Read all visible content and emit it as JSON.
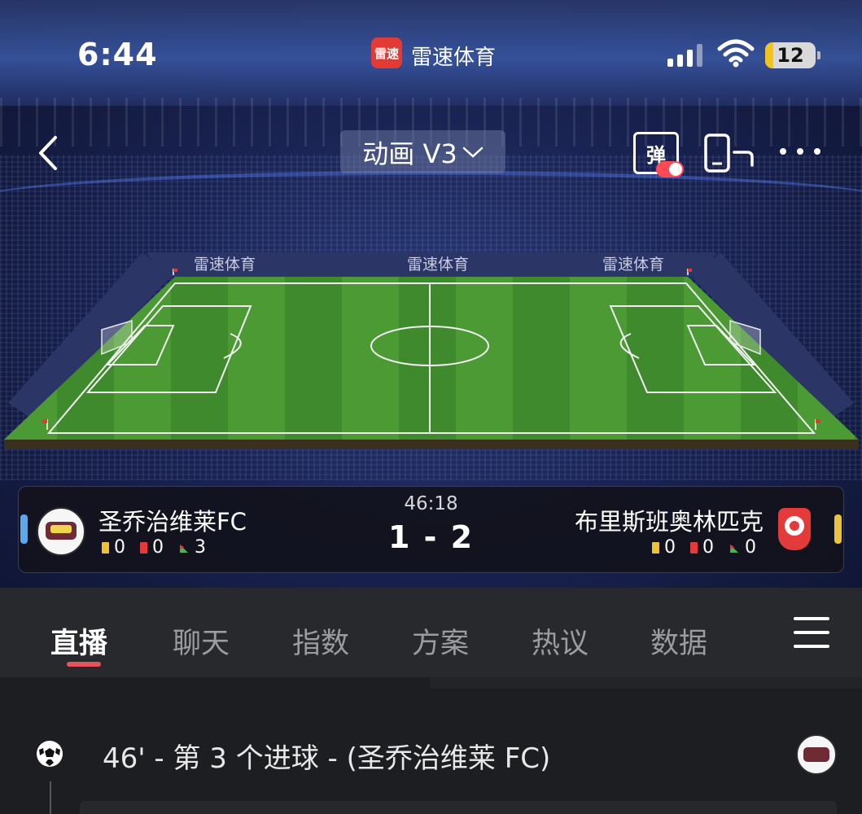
{
  "status_bar": {
    "time": "6:44",
    "app_badge": "雷速",
    "app_name": "雷速体育",
    "battery": "12"
  },
  "nav": {
    "mode_label": "动画 V3",
    "danmu_label": "弹"
  },
  "pitch": {
    "board_brand": "雷速体育",
    "grass_color": "#3f8a2c",
    "grass_stripe_color": "#4b9a33"
  },
  "match": {
    "clock": "46:18",
    "score": "1 - 2",
    "home": {
      "name": "圣乔治维莱FC",
      "yellow_cards": "0",
      "red_cards": "0",
      "corners": "3"
    },
    "away": {
      "name": "布里斯班奥林匹克",
      "yellow_cards": "0",
      "red_cards": "0",
      "corners": "0"
    }
  },
  "tabs": [
    {
      "label": "直播",
      "active": true
    },
    {
      "label": "聊天",
      "active": false
    },
    {
      "label": "指数",
      "active": false
    },
    {
      "label": "方案",
      "active": false
    },
    {
      "label": "热议",
      "active": false
    },
    {
      "label": "数据",
      "active": false
    }
  ],
  "feed": {
    "events": [
      {
        "text": "46' - 第 3 个进球 - (圣乔治维莱 FC)",
        "icon": "soccer-ball-icon"
      }
    ]
  },
  "colors": {
    "accent": "#e6545b",
    "home_strip": "#5aa9ee",
    "away_strip": "#e9c33b",
    "app_red": "#e23a34"
  }
}
